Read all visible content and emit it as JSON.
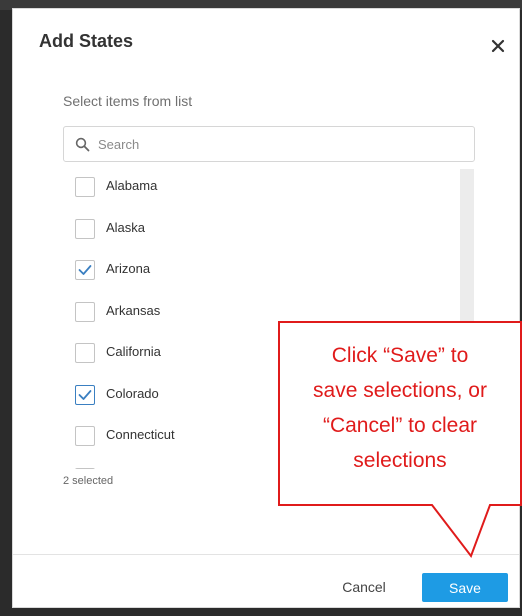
{
  "dialog": {
    "title": "Add States",
    "close_icon": "close-icon",
    "section_label": "Select items from list",
    "search": {
      "placeholder": "Search",
      "value": "",
      "icon": "search-icon"
    },
    "items": [
      {
        "label": "Alabama",
        "checked": false
      },
      {
        "label": "Alaska",
        "checked": false
      },
      {
        "label": "Arizona",
        "checked": true
      },
      {
        "label": "Arkansas",
        "checked": false
      },
      {
        "label": "California",
        "checked": false
      },
      {
        "label": "Colorado",
        "checked": true
      },
      {
        "label": "Connecticut",
        "checked": false
      },
      {
        "label": "Delaware",
        "checked": false
      }
    ],
    "selected_count_text": "2 selected",
    "footer": {
      "cancel_label": "Cancel",
      "save_label": "Save"
    }
  },
  "callout": {
    "text_lines": [
      "Click “Save” to",
      "save selections, or",
      "“Cancel” to clear",
      "selections"
    ],
    "color": "#e01b1b"
  },
  "colors": {
    "primary_button": "#1e9be4",
    "checkmark": "#3a7fc1",
    "annotation": "#e01b1b"
  }
}
